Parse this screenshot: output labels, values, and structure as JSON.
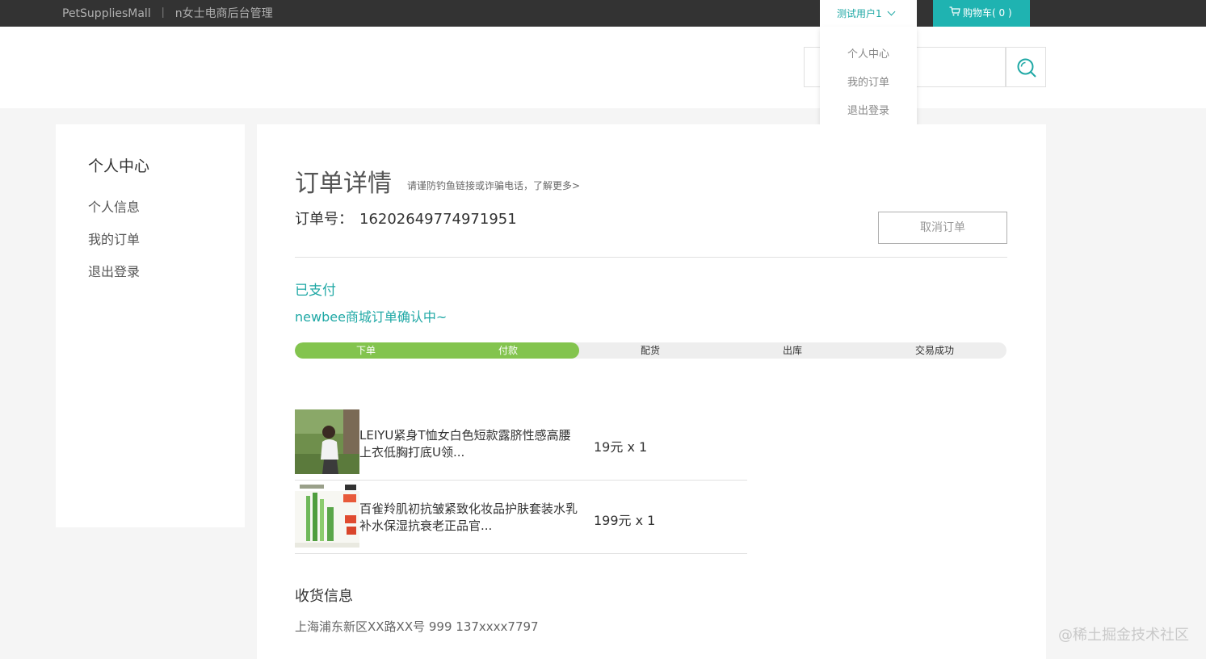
{
  "topbar": {
    "brand_left": "PetSuppliesMall",
    "brand_separator": "丨",
    "brand_right": "n女士电商后台管理",
    "user_name": "测试用户1",
    "cart_label": "购物车( 0 )"
  },
  "dropdown": {
    "items": [
      "个人中心",
      "我的订单",
      "退出登录"
    ]
  },
  "sidebar": {
    "title": "个人中心",
    "items": [
      "个人信息",
      "我的订单",
      "退出登录"
    ]
  },
  "order": {
    "title": "订单详情",
    "tip": "请谨防钓鱼链接或诈骗电话，了解更多>",
    "number_label": "订单号：",
    "number": "16202649774971951",
    "cancel_label": "取消订单",
    "status": "已支付",
    "status_desc": "newbee商城订单确认中~",
    "steps": [
      "下单",
      "付款",
      "配货",
      "出库",
      "交易成功"
    ],
    "steps_completed": 2
  },
  "goods": [
    {
      "name_line1": "LEIYU紧身T恤女白色短款露脐性感高腰",
      "name_line2": "上衣低胸打底U领...",
      "price": "19元 x 1"
    },
    {
      "name_line1": "百雀羚肌初抗皱紧致化妆品护肤套装水乳",
      "name_line2": "补水保湿抗衰老正品官...",
      "price": "199元 x 1"
    }
  ],
  "shipping": {
    "title": "收货信息",
    "address": "上海浦东新区XX路XX号 999 137xxxx7797"
  },
  "watermark": "@稀土掘金技术社区",
  "colors": {
    "accent": "#1fa8a5",
    "progress_done": "#83c44e",
    "topbar_bg": "#333333"
  }
}
